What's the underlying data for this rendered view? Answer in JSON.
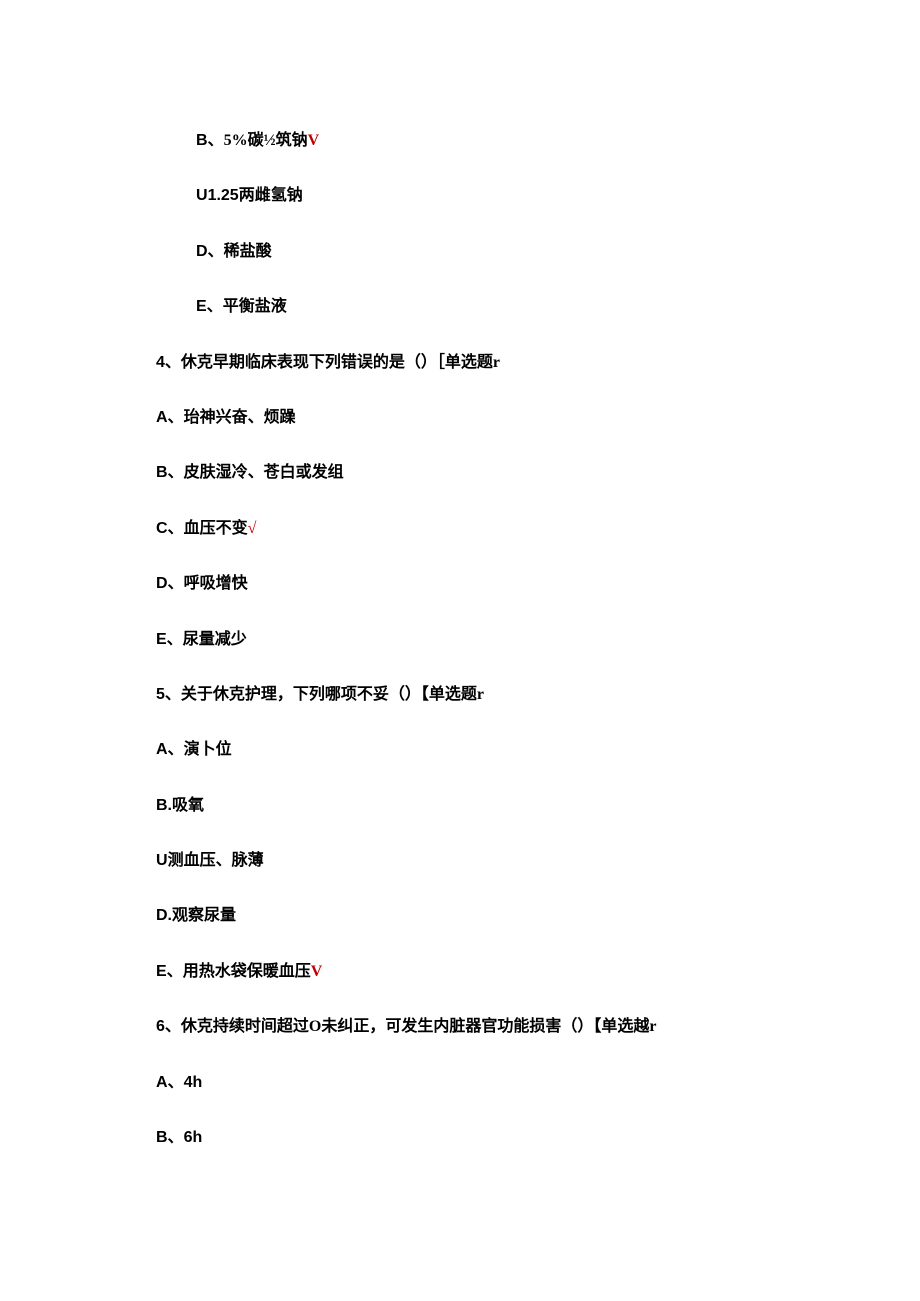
{
  "items": {
    "opt_b_prev": {
      "prefix": "B、",
      "text": "5%碳½筑钠",
      "mark": "V"
    },
    "opt_c_prev": {
      "prefix": "U",
      "text": "1.25两雌氢钠"
    },
    "opt_d_prev": {
      "prefix": "D、",
      "text": "稀盐酸"
    },
    "opt_e_prev": {
      "prefix": "E、",
      "text": "平衡盐液"
    },
    "q4": {
      "num": "4、",
      "text": "休克早期临床表现下列错误的是（）［单选题r"
    },
    "q4_a": {
      "prefix": "A、",
      "text": "珆神兴奋、烦躁"
    },
    "q4_b": {
      "prefix": "B、",
      "text": "皮肤湿冷、苍白或发组"
    },
    "q4_c": {
      "prefix": "C、",
      "text": "血压不变",
      "mark": "√"
    },
    "q4_d": {
      "prefix": "D、",
      "text": "呼吸增快"
    },
    "q4_e": {
      "prefix": "E、",
      "text": "尿量减少"
    },
    "q5": {
      "num": "5、",
      "text": "关于休克护理，下列哪项不妥（）【单选题r"
    },
    "q5_a": {
      "prefix": "A、",
      "text": "演卜位"
    },
    "q5_b": {
      "prefix": "B.",
      "text": "吸氧"
    },
    "q5_c": {
      "prefix": "U",
      "text": "测血压、脉薄"
    },
    "q5_d": {
      "prefix": "D.",
      "text": "观察尿量"
    },
    "q5_e": {
      "prefix": "E、",
      "text": "用热水袋保暖血压",
      "mark": "V"
    },
    "q6": {
      "num": "6、",
      "text": "休克持续时间超过O未纠正，可发生内脏器官功能损害（）【单选越r"
    },
    "q6_a": {
      "prefix": "A、",
      "text": "4h"
    },
    "q6_b": {
      "prefix": "B、",
      "text": "6h"
    }
  }
}
